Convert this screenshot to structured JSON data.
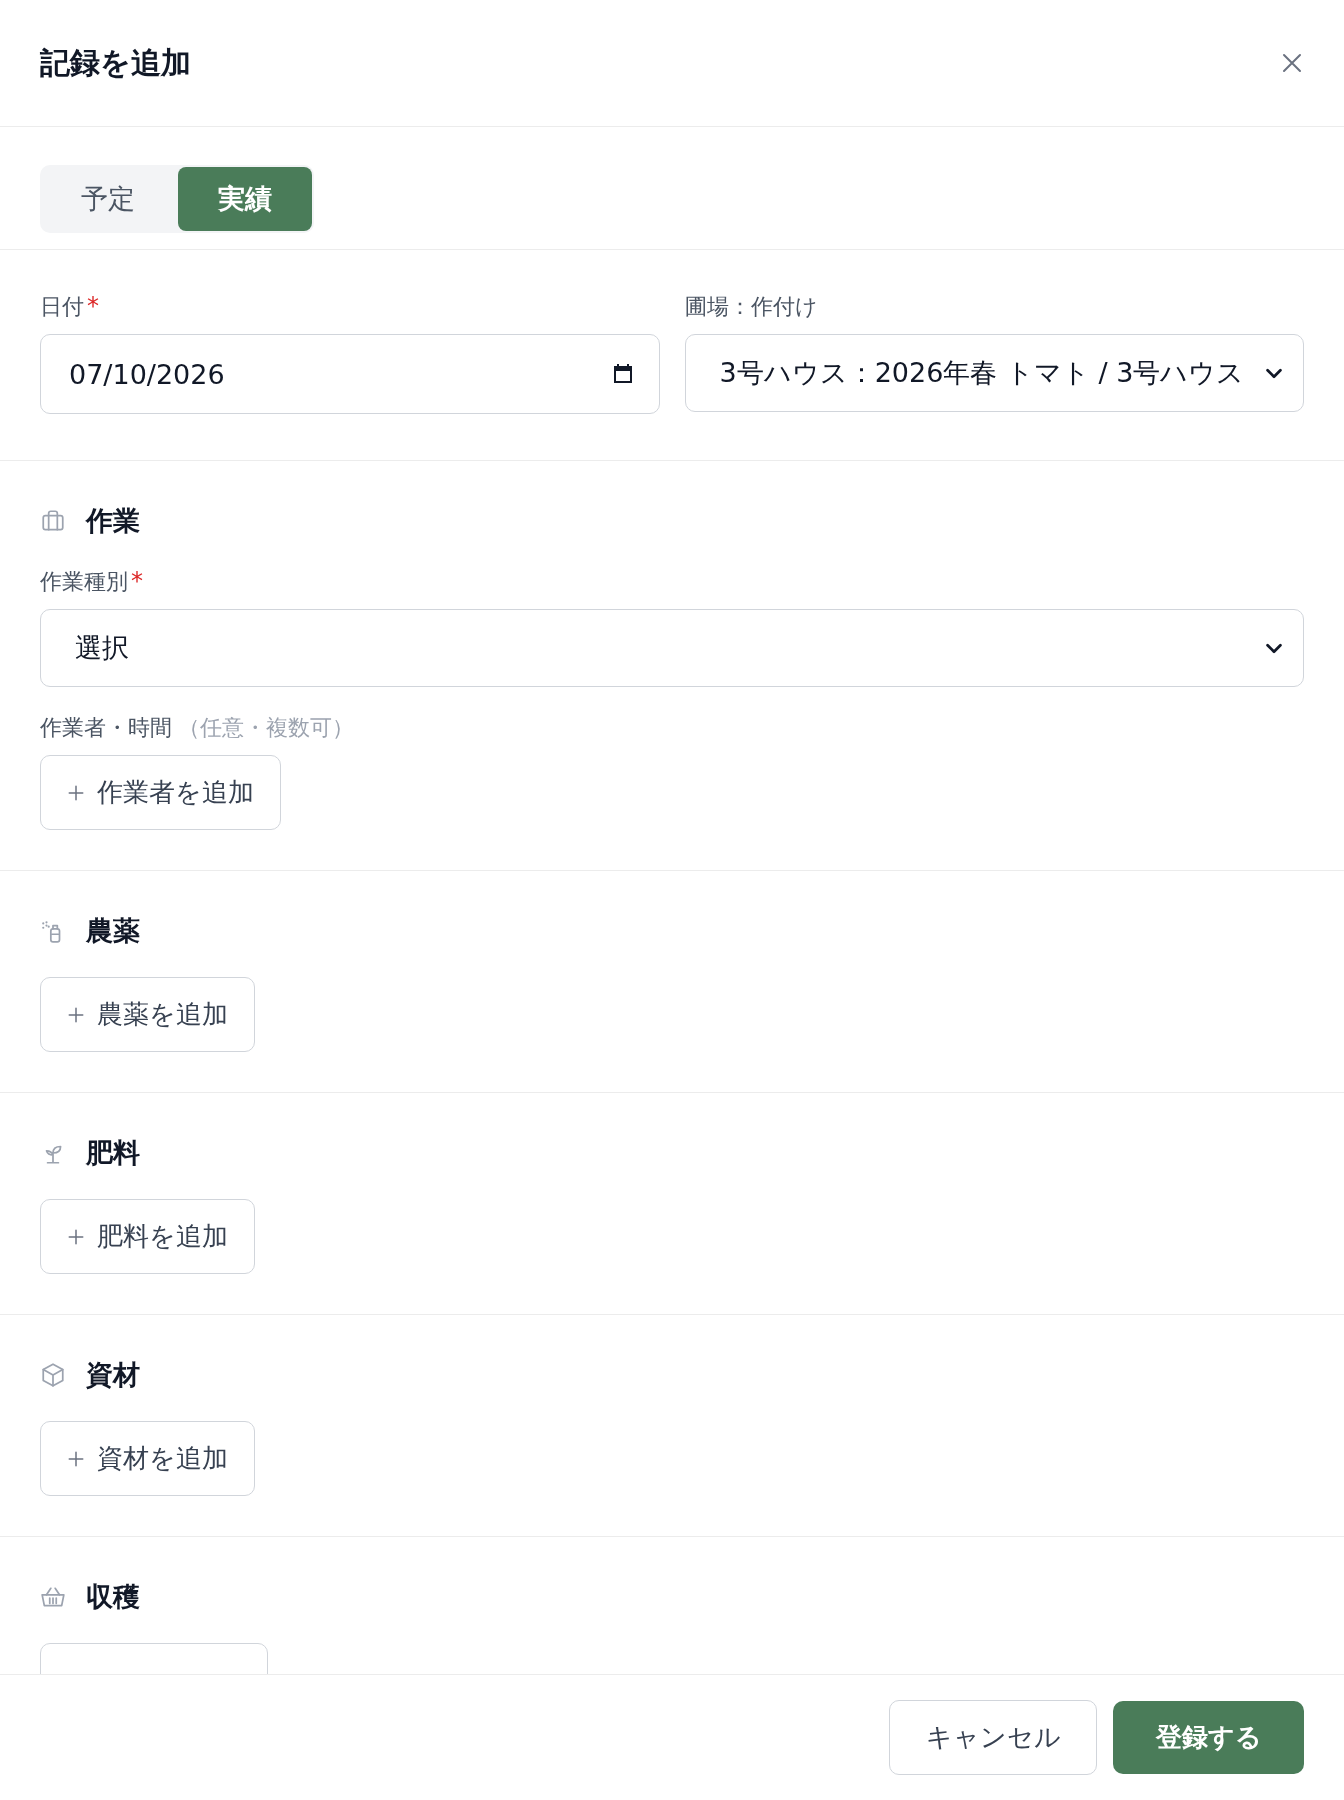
{
  "dialog": {
    "title": "記録を追加"
  },
  "mode_tabs": [
    {
      "label": "予定",
      "selected": false
    },
    {
      "label": "実績",
      "selected": true
    }
  ],
  "fields": [
    {
      "kind": "date",
      "label": "日付",
      "required_mark": "*",
      "value": "07/10/2026"
    },
    {
      "kind": "select",
      "label": "圃場：作付け",
      "value": "3号ハウス：2026年春 トマト / 3号ハウス"
    }
  ],
  "sections": [
    {
      "title": "作業",
      "work_type": {
        "label": "作業種別",
        "required_mark": "*",
        "value": "選択"
      },
      "workers": {
        "label": "作業者・時間",
        "hint": "（任意・複数可）"
      },
      "add_button": "作業者を追加"
    },
    {
      "title": "農薬",
      "add_button": "農薬を追加"
    },
    {
      "title": "肥料",
      "add_button": "肥料を追加"
    },
    {
      "title": "資材",
      "add_button": "資材を追加"
    },
    {
      "title": "収穫",
      "add_button_cut_off": true
    }
  ],
  "footer": {
    "cancel": "キャンセル",
    "submit": "登録する"
  }
}
